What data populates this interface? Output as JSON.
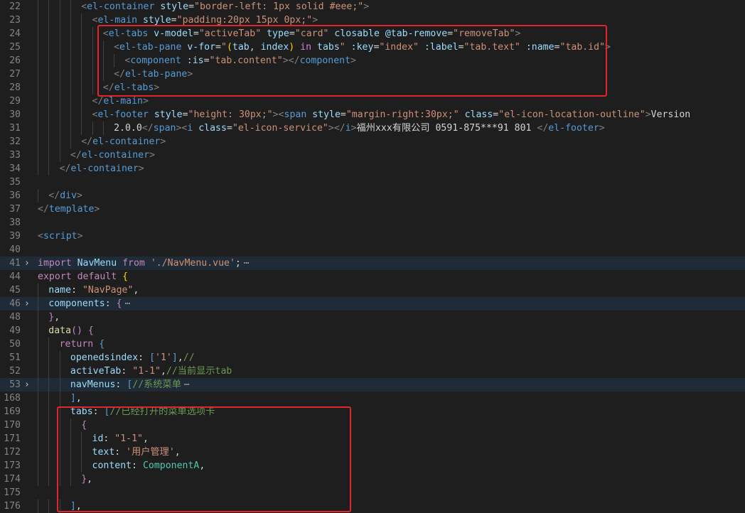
{
  "colors": {
    "background": "#1e1e1e",
    "line_number": "#858585",
    "tag": "#569cd6",
    "bracket_tag": "#808080",
    "attribute": "#9cdcfe",
    "string": "#ce9178",
    "text": "#d4d4d4",
    "comment": "#6a9955",
    "keyword": "#c586c0",
    "function": "#dcdcaa",
    "bracket": "#ffd700",
    "class": "#4ec9b0",
    "highlight_box": "#e0262a"
  },
  "lines": [
    {
      "n": "22",
      "indent": 4,
      "fold": false,
      "hl": false,
      "tokens": [
        {
          "t": "<",
          "c": "bracket_tag"
        },
        {
          "t": "el-container",
          "c": "tag"
        },
        {
          "t": " style",
          "c": "attribute"
        },
        {
          "t": "=",
          "c": "text"
        },
        {
          "t": "\"border-left: 1px solid #eee;\"",
          "c": "string"
        },
        {
          "t": ">",
          "c": "bracket_tag"
        }
      ]
    },
    {
      "n": "23",
      "indent": 5,
      "fold": false,
      "hl": false,
      "tokens": [
        {
          "t": "<",
          "c": "bracket_tag"
        },
        {
          "t": "el-main",
          "c": "tag"
        },
        {
          "t": " style",
          "c": "attribute"
        },
        {
          "t": "=",
          "c": "text"
        },
        {
          "t": "\"padding:20px 15px 0px;\"",
          "c": "string"
        },
        {
          "t": ">",
          "c": "bracket_tag"
        }
      ]
    },
    {
      "n": "24",
      "indent": 6,
      "fold": false,
      "hl": false,
      "tokens": [
        {
          "t": "<",
          "c": "bracket_tag"
        },
        {
          "t": "el-tabs",
          "c": "tag"
        },
        {
          "t": " v-model",
          "c": "attribute"
        },
        {
          "t": "=",
          "c": "text"
        },
        {
          "t": "\"activeTab\"",
          "c": "string"
        },
        {
          "t": " type",
          "c": "attribute"
        },
        {
          "t": "=",
          "c": "text"
        },
        {
          "t": "\"card\"",
          "c": "string"
        },
        {
          "t": " closable",
          "c": "attribute"
        },
        {
          "t": " @tab-remove",
          "c": "attribute"
        },
        {
          "t": "=",
          "c": "text"
        },
        {
          "t": "\"removeTab\"",
          "c": "string"
        },
        {
          "t": ">",
          "c": "bracket_tag"
        }
      ]
    },
    {
      "n": "25",
      "indent": 7,
      "fold": false,
      "hl": false,
      "tokens": [
        {
          "t": "<",
          "c": "bracket_tag"
        },
        {
          "t": "el-tab-pane",
          "c": "tag"
        },
        {
          "t": " v-for",
          "c": "attribute"
        },
        {
          "t": "=",
          "c": "text"
        },
        {
          "t": "\"",
          "c": "string"
        },
        {
          "t": "(",
          "c": "bracket"
        },
        {
          "t": "tab, index",
          "c": "attribute"
        },
        {
          "t": ")",
          "c": "bracket"
        },
        {
          "t": " in ",
          "c": "keyword"
        },
        {
          "t": "tabs",
          "c": "attribute"
        },
        {
          "t": "\"",
          "c": "string"
        },
        {
          "t": " :key",
          "c": "attribute"
        },
        {
          "t": "=",
          "c": "text"
        },
        {
          "t": "\"index\"",
          "c": "string"
        },
        {
          "t": " :label",
          "c": "attribute"
        },
        {
          "t": "=",
          "c": "text"
        },
        {
          "t": "\"tab.text\"",
          "c": "string"
        },
        {
          "t": " :name",
          "c": "attribute"
        },
        {
          "t": "=",
          "c": "text"
        },
        {
          "t": "\"tab.id\"",
          "c": "string"
        },
        {
          "t": ">",
          "c": "bracket_tag"
        }
      ]
    },
    {
      "n": "26",
      "indent": 8,
      "fold": false,
      "hl": false,
      "tokens": [
        {
          "t": "<",
          "c": "bracket_tag"
        },
        {
          "t": "component",
          "c": "tag"
        },
        {
          "t": " :is",
          "c": "attribute"
        },
        {
          "t": "=",
          "c": "text"
        },
        {
          "t": "\"tab.content\"",
          "c": "string"
        },
        {
          "t": "></",
          "c": "bracket_tag"
        },
        {
          "t": "component",
          "c": "tag"
        },
        {
          "t": ">",
          "c": "bracket_tag"
        }
      ]
    },
    {
      "n": "27",
      "indent": 7,
      "fold": false,
      "hl": false,
      "tokens": [
        {
          "t": "</",
          "c": "bracket_tag"
        },
        {
          "t": "el-tab-pane",
          "c": "tag"
        },
        {
          "t": ">",
          "c": "bracket_tag"
        }
      ]
    },
    {
      "n": "28",
      "indent": 6,
      "fold": false,
      "hl": false,
      "tokens": [
        {
          "t": "</",
          "c": "bracket_tag"
        },
        {
          "t": "el-tabs",
          "c": "tag"
        },
        {
          "t": ">",
          "c": "bracket_tag"
        }
      ]
    },
    {
      "n": "29",
      "indent": 5,
      "fold": false,
      "hl": false,
      "tokens": [
        {
          "t": "</",
          "c": "bracket_tag"
        },
        {
          "t": "el-main",
          "c": "tag"
        },
        {
          "t": ">",
          "c": "bracket_tag"
        }
      ]
    },
    {
      "n": "30",
      "indent": 5,
      "fold": false,
      "hl": false,
      "tokens": [
        {
          "t": "<",
          "c": "bracket_tag"
        },
        {
          "t": "el-footer",
          "c": "tag"
        },
        {
          "t": " style",
          "c": "attribute"
        },
        {
          "t": "=",
          "c": "text"
        },
        {
          "t": "\"height: 30px;\"",
          "c": "string"
        },
        {
          "t": "><",
          "c": "bracket_tag"
        },
        {
          "t": "span",
          "c": "tag"
        },
        {
          "t": " style",
          "c": "attribute"
        },
        {
          "t": "=",
          "c": "text"
        },
        {
          "t": "\"margin-right:30px;\"",
          "c": "string"
        },
        {
          "t": " class",
          "c": "attribute"
        },
        {
          "t": "=",
          "c": "text"
        },
        {
          "t": "\"el-icon-location-outline\"",
          "c": "string"
        },
        {
          "t": ">",
          "c": "bracket_tag"
        },
        {
          "t": "Version",
          "c": "text"
        }
      ]
    },
    {
      "n": "31",
      "indent": 7,
      "fold": false,
      "hl": false,
      "tokens": [
        {
          "t": "2.0.0",
          "c": "text"
        },
        {
          "t": "</",
          "c": "bracket_tag"
        },
        {
          "t": "span",
          "c": "tag"
        },
        {
          "t": "><",
          "c": "bracket_tag"
        },
        {
          "t": "i",
          "c": "tag"
        },
        {
          "t": " class",
          "c": "attribute"
        },
        {
          "t": "=",
          "c": "text"
        },
        {
          "t": "\"el-icon-service\"",
          "c": "string"
        },
        {
          "t": "></",
          "c": "bracket_tag"
        },
        {
          "t": "i",
          "c": "tag"
        },
        {
          "t": ">",
          "c": "bracket_tag"
        },
        {
          "t": "福州xxx有限公司 0591-875***91 801 ",
          "c": "text"
        },
        {
          "t": "</",
          "c": "bracket_tag"
        },
        {
          "t": "el-footer",
          "c": "tag"
        },
        {
          "t": ">",
          "c": "bracket_tag"
        }
      ]
    },
    {
      "n": "32",
      "indent": 4,
      "fold": false,
      "hl": false,
      "tokens": [
        {
          "t": "</",
          "c": "bracket_tag"
        },
        {
          "t": "el-container",
          "c": "tag"
        },
        {
          "t": ">",
          "c": "bracket_tag"
        }
      ]
    },
    {
      "n": "33",
      "indent": 3,
      "fold": false,
      "hl": false,
      "tokens": [
        {
          "t": "</",
          "c": "bracket_tag"
        },
        {
          "t": "el-container",
          "c": "tag"
        },
        {
          "t": ">",
          "c": "bracket_tag"
        }
      ]
    },
    {
      "n": "34",
      "indent": 2,
      "fold": false,
      "hl": false,
      "tokens": [
        {
          "t": "</",
          "c": "bracket_tag"
        },
        {
          "t": "el-container",
          "c": "tag"
        },
        {
          "t": ">",
          "c": "bracket_tag"
        }
      ]
    },
    {
      "n": "35",
      "indent": 0,
      "fold": false,
      "hl": false,
      "tokens": []
    },
    {
      "n": "36",
      "indent": 1,
      "fold": false,
      "hl": false,
      "tokens": [
        {
          "t": "</",
          "c": "bracket_tag"
        },
        {
          "t": "div",
          "c": "tag"
        },
        {
          "t": ">",
          "c": "bracket_tag"
        }
      ]
    },
    {
      "n": "37",
      "indent": 0,
      "fold": false,
      "hl": false,
      "tokens": [
        {
          "t": "</",
          "c": "bracket_tag"
        },
        {
          "t": "template",
          "c": "tag"
        },
        {
          "t": ">",
          "c": "bracket_tag"
        }
      ]
    },
    {
      "n": "38",
      "indent": 0,
      "fold": false,
      "hl": false,
      "tokens": []
    },
    {
      "n": "39",
      "indent": 0,
      "fold": false,
      "hl": false,
      "tokens": [
        {
          "t": "<",
          "c": "bracket_tag"
        },
        {
          "t": "script",
          "c": "tag"
        },
        {
          "t": ">",
          "c": "bracket_tag"
        }
      ]
    },
    {
      "n": "40",
      "indent": 0,
      "fold": false,
      "hl": false,
      "tokens": []
    },
    {
      "n": "41",
      "indent": 0,
      "fold": true,
      "hl": true,
      "tokens": [
        {
          "t": "import",
          "c": "keyword"
        },
        {
          "t": " NavMenu ",
          "c": "attribute"
        },
        {
          "t": "from",
          "c": "keyword"
        },
        {
          "t": " './NavMenu.vue'",
          "c": "string"
        },
        {
          "t": ";",
          "c": "text"
        }
      ],
      "ellipsis": "⋯"
    },
    {
      "n": "44",
      "indent": 0,
      "fold": false,
      "hl": false,
      "tokens": [
        {
          "t": "export",
          "c": "keyword"
        },
        {
          "t": " default ",
          "c": "keyword"
        },
        {
          "t": "{",
          "c": "bracket"
        }
      ]
    },
    {
      "n": "45",
      "indent": 1,
      "fold": false,
      "hl": false,
      "tokens": [
        {
          "t": "name",
          "c": "attribute"
        },
        {
          "t": ": ",
          "c": "text"
        },
        {
          "t": "\"NavPage\"",
          "c": "string"
        },
        {
          "t": ",",
          "c": "text"
        }
      ]
    },
    {
      "n": "46",
      "indent": 1,
      "fold": true,
      "hl": true,
      "tokens": [
        {
          "t": "components",
          "c": "attribute"
        },
        {
          "t": ": ",
          "c": "text"
        },
        {
          "t": "{",
          "c": "keyword"
        }
      ],
      "ellipsis": "⋯"
    },
    {
      "n": "48",
      "indent": 1,
      "fold": false,
      "hl": false,
      "tokens": [
        {
          "t": "}",
          "c": "keyword"
        },
        {
          "t": ",",
          "c": "text"
        }
      ]
    },
    {
      "n": "49",
      "indent": 1,
      "fold": false,
      "hl": false,
      "tokens": [
        {
          "t": "data",
          "c": "function"
        },
        {
          "t": "() ",
          "c": "keyword"
        },
        {
          "t": "{",
          "c": "keyword"
        }
      ]
    },
    {
      "n": "50",
      "indent": 2,
      "fold": false,
      "hl": false,
      "tokens": [
        {
          "t": "return",
          "c": "keyword"
        },
        {
          "t": " ",
          "c": "text"
        },
        {
          "t": "{",
          "c": "tag"
        }
      ]
    },
    {
      "n": "51",
      "indent": 3,
      "fold": false,
      "hl": false,
      "tokens": [
        {
          "t": "openedsindex",
          "c": "attribute"
        },
        {
          "t": ": ",
          "c": "text"
        },
        {
          "t": "[",
          "c": "tag"
        },
        {
          "t": "'1'",
          "c": "string"
        },
        {
          "t": "]",
          "c": "tag"
        },
        {
          "t": ",",
          "c": "text"
        },
        {
          "t": "//",
          "c": "comment"
        }
      ]
    },
    {
      "n": "52",
      "indent": 3,
      "fold": false,
      "hl": false,
      "tokens": [
        {
          "t": "activeTab",
          "c": "attribute"
        },
        {
          "t": ": ",
          "c": "text"
        },
        {
          "t": "\"1-1\"",
          "c": "string"
        },
        {
          "t": ",",
          "c": "text"
        },
        {
          "t": "//当前显示tab",
          "c": "comment"
        }
      ]
    },
    {
      "n": "53",
      "indent": 3,
      "fold": true,
      "hl": true,
      "tokens": [
        {
          "t": "navMenus",
          "c": "attribute"
        },
        {
          "t": ": ",
          "c": "text"
        },
        {
          "t": "[",
          "c": "tag"
        },
        {
          "t": "//系统菜单",
          "c": "comment"
        }
      ],
      "ellipsis": "⋯"
    },
    {
      "n": "168",
      "indent": 3,
      "fold": false,
      "hl": false,
      "tokens": [
        {
          "t": "]",
          "c": "tag"
        },
        {
          "t": ",",
          "c": "text"
        }
      ]
    },
    {
      "n": "169",
      "indent": 3,
      "fold": false,
      "hl": false,
      "tokens": [
        {
          "t": "tabs",
          "c": "attribute"
        },
        {
          "t": ": ",
          "c": "text"
        },
        {
          "t": "[",
          "c": "tag"
        },
        {
          "t": "//已经打开的菜单选项卡",
          "c": "comment"
        }
      ]
    },
    {
      "n": "170",
      "indent": 4,
      "fold": false,
      "hl": false,
      "tokens": [
        {
          "t": "{",
          "c": "keyword"
        }
      ]
    },
    {
      "n": "171",
      "indent": 5,
      "fold": false,
      "hl": false,
      "tokens": [
        {
          "t": "id",
          "c": "attribute"
        },
        {
          "t": ": ",
          "c": "text"
        },
        {
          "t": "\"1-1\"",
          "c": "string"
        },
        {
          "t": ",",
          "c": "text"
        }
      ]
    },
    {
      "n": "172",
      "indent": 5,
      "fold": false,
      "hl": false,
      "tokens": [
        {
          "t": "text",
          "c": "attribute"
        },
        {
          "t": ": ",
          "c": "text"
        },
        {
          "t": "'用户管理'",
          "c": "string"
        },
        {
          "t": ",",
          "c": "text"
        }
      ]
    },
    {
      "n": "173",
      "indent": 5,
      "fold": false,
      "hl": false,
      "tokens": [
        {
          "t": "content",
          "c": "attribute"
        },
        {
          "t": ": ",
          "c": "text"
        },
        {
          "t": "ComponentA",
          "c": "class"
        },
        {
          "t": ",",
          "c": "text"
        }
      ]
    },
    {
      "n": "174",
      "indent": 4,
      "fold": false,
      "hl": false,
      "tokens": [
        {
          "t": "}",
          "c": "keyword"
        },
        {
          "t": ",",
          "c": "text"
        }
      ]
    },
    {
      "n": "175",
      "indent": 0,
      "fold": false,
      "hl": false,
      "tokens": []
    },
    {
      "n": "176",
      "indent": 3,
      "fold": false,
      "hl": false,
      "tokens": [
        {
          "t": "]",
          "c": "tag"
        },
        {
          "t": ",",
          "c": "text"
        }
      ]
    }
  ]
}
